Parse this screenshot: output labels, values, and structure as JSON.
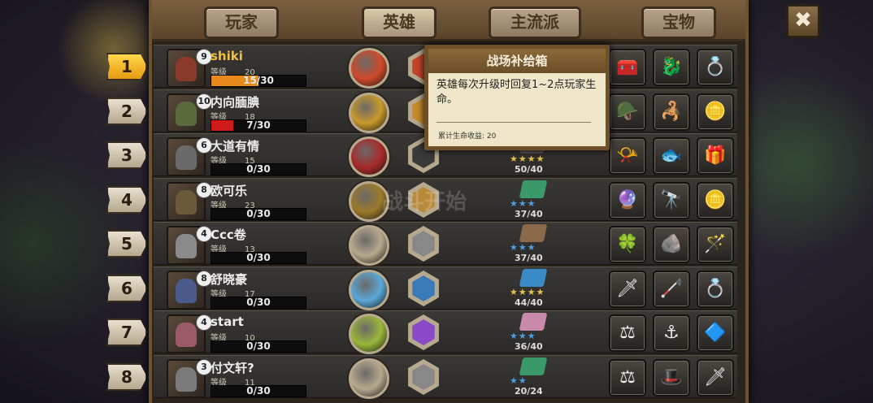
{
  "tabs": [
    "玩家",
    "英雄",
    "主流派",
    "宝物"
  ],
  "active_tab": 1,
  "close_label": "✖",
  "watermark": "战斗开始",
  "tooltip": {
    "title": "战场补给箱",
    "body": "英雄每次升级时回复1~2点玩家生命。",
    "footer": "累计生命收益: 20"
  },
  "grade_label": "等级",
  "players": [
    {
      "rank": "1",
      "name": "shiki",
      "level": "9",
      "grade": "20",
      "hp": "15/30",
      "hp_value": 15,
      "hp_max": 30,
      "hp_color": "#e8891c",
      "me": true,
      "circle": "#d04a2a",
      "hex": "#c6442a",
      "book": "",
      "stars": "",
      "count": "",
      "items": [
        "🧰",
        "🐉",
        "💍"
      ],
      "pcolor": "#8a3a2a"
    },
    {
      "rank": "2",
      "name": "内向腼腆",
      "level": "10",
      "grade": "18",
      "hp": "7/30",
      "hp_value": 7,
      "hp_max": 30,
      "hp_color": "#d01a1a",
      "me": false,
      "circle": "#c99a2a",
      "hex": "#c98a2a",
      "book": "",
      "stars": "",
      "count": "",
      "items": [
        "🪖",
        "🦂",
        "🪙"
      ],
      "pcolor": "#5a6a3a"
    },
    {
      "rank": "3",
      "name": "大道有情",
      "level": "6",
      "grade": "15",
      "hp": "0/30",
      "hp_value": 0,
      "hp_max": 30,
      "hp_color": "#666",
      "me": false,
      "circle": "#a82a2a",
      "hex": "#3a3a3a",
      "book": "#555",
      "stars": "★★★★",
      "count": "50/40",
      "items": [
        "📯",
        "🐟",
        "🎁"
      ],
      "pcolor": "#6a6a6a"
    },
    {
      "rank": "4",
      "name": "欧可乐",
      "level": "8",
      "grade": "23",
      "hp": "0/30",
      "hp_value": 0,
      "hp_max": 30,
      "hp_color": "#666",
      "me": false,
      "circle": "#9c7a2a",
      "hex": "#b78a3a",
      "book": "#3a9a6a",
      "stars": "★★★",
      "count": "37/40",
      "items": [
        "🔮",
        "🔭",
        "🪙"
      ],
      "pcolor": "#6a5a3a"
    },
    {
      "rank": "5",
      "name": "Ccc卷",
      "level": "4",
      "grade": "13",
      "hp": "0/30",
      "hp_value": 0,
      "hp_max": 30,
      "hp_color": "#666",
      "me": false,
      "circle": "#b7a98e",
      "hex": "#888",
      "book": "#8a6a4a",
      "stars": "★★★",
      "count": "37/40",
      "items": [
        "🍀",
        "🪨",
        "🪄"
      ],
      "pcolor": "#8a8a8a"
    },
    {
      "rank": "6",
      "name": "舒晓豪",
      "level": "8",
      "grade": "17",
      "hp": "0/30",
      "hp_value": 0,
      "hp_max": 30,
      "hp_color": "#666",
      "me": false,
      "circle": "#5aa8d8",
      "hex": "#3a7ab8",
      "book": "#3a8ac8",
      "stars": "★★★★",
      "count": "44/40",
      "items": [
        "🗡",
        "🦯",
        "💍"
      ],
      "pcolor": "#4a5a8a"
    },
    {
      "rank": "7",
      "name": "start",
      "level": "4",
      "grade": "10",
      "hp": "0/30",
      "hp_value": 0,
      "hp_max": 30,
      "hp_color": "#666",
      "me": false,
      "circle": "#9ab83a",
      "hex": "#8a4ac8",
      "book": "#c88aa8",
      "stars": "★★★",
      "count": "36/40",
      "items": [
        "⚖",
        "⚓",
        "🔷"
      ],
      "pcolor": "#9a5a6a"
    },
    {
      "rank": "8",
      "name": "付文轩?",
      "level": "3",
      "grade": "11",
      "hp": "0/30",
      "hp_value": 0,
      "hp_max": 30,
      "hp_color": "#666",
      "me": false,
      "circle": "#b7a98e",
      "hex": "#888",
      "book": "#3a9a6a",
      "stars": "★★",
      "count": "20/24",
      "items": [
        "⚖",
        "🎩",
        "🗡"
      ],
      "pcolor": "#7a7a7a"
    }
  ]
}
